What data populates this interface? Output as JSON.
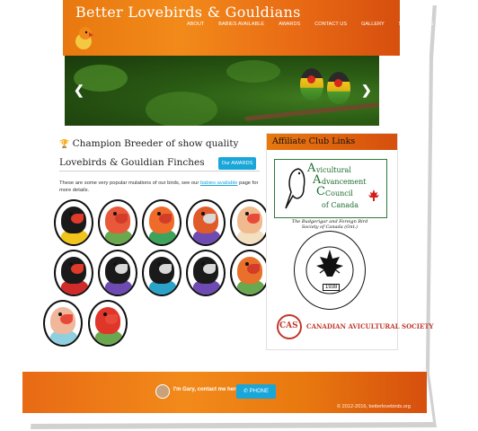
{
  "site": {
    "title": "Better Lovebirds & Gouldians",
    "nav": [
      "ABOUT",
      "BABIES AVAILABLE",
      "AWARDS",
      "CONTACT US",
      "GALLERY",
      "SHOW BOXES"
    ]
  },
  "slider": {
    "prev_icon": "chevron-left-icon",
    "next_icon": "chevron-right-icon",
    "prev": "❮",
    "next": "❯"
  },
  "main": {
    "title_icon": "trophy-icon",
    "trophy": "🏆",
    "title": "Champion Breeder of show quality Lovebirds & Gouldian Finches",
    "awards_button": "Our AWARDS",
    "intro_pre": "These are some very popular mutations of our birds, see our",
    "intro_link": "babies available",
    "intro_post": "page for more details."
  },
  "sidebar": {
    "heading": "Affiliate Club Links",
    "clubs": [
      {
        "name_lines": [
          "vicultural",
          "dvancement",
          "Council",
          "of Canada"
        ],
        "initials": [
          "A",
          "A",
          "C"
        ]
      },
      {
        "name": "The Budgerigar and Foreign Bird Society of Canada (Ont.)",
        "year": "1938"
      },
      {
        "name": "CANADIAN AVICULTURAL SOCIETY",
        "initials": "CAS"
      }
    ]
  },
  "birds": [
    {
      "head": "#1a1a1a",
      "beak": "#e03a2a",
      "body": "#f2c51c"
    },
    {
      "head": "#e8583a",
      "beak": "#d33c28",
      "body": "#6aa84f"
    },
    {
      "head": "#ef6b2a",
      "beak": "#d33c28",
      "body": "#3da35a"
    },
    {
      "head": "#e05a2a",
      "beak": "#d8d8d8",
      "body": "#6d4bb3"
    },
    {
      "head": "#f1b98e",
      "beak": "#e84a3a",
      "body": "#f3e0c0"
    },
    {
      "head": "#1a1a1a",
      "beak": "#e03a2a",
      "body": "#d02a2a"
    },
    {
      "head": "#1a1a1a",
      "beak": "#d8d8d8",
      "body": "#6d4bb3"
    },
    {
      "head": "#1a1a1a",
      "beak": "#d8d8d8",
      "body": "#2aa3c9"
    },
    {
      "head": "#1a1a1a",
      "beak": "#d8d8d8",
      "body": "#6d4bb3"
    },
    {
      "head": "#e8702a",
      "beak": "#d33c28",
      "body": "#6aa84f"
    },
    {
      "head": "#f0b79a",
      "beak": "#e84a3a",
      "body": "#8fd0e0"
    },
    {
      "head": "#e0362a",
      "beak": "#e84a3a",
      "body": "#6aa84f"
    }
  ],
  "footer": {
    "contact": "I'm  Gary, contact me here",
    "phone": "PHONE",
    "phone_icon": "phone-icon",
    "copyright": "© 2012-2016, betterlovebirds.org"
  },
  "colors": {
    "orange": "#e8780f",
    "accent_blue": "#19a6d9"
  }
}
